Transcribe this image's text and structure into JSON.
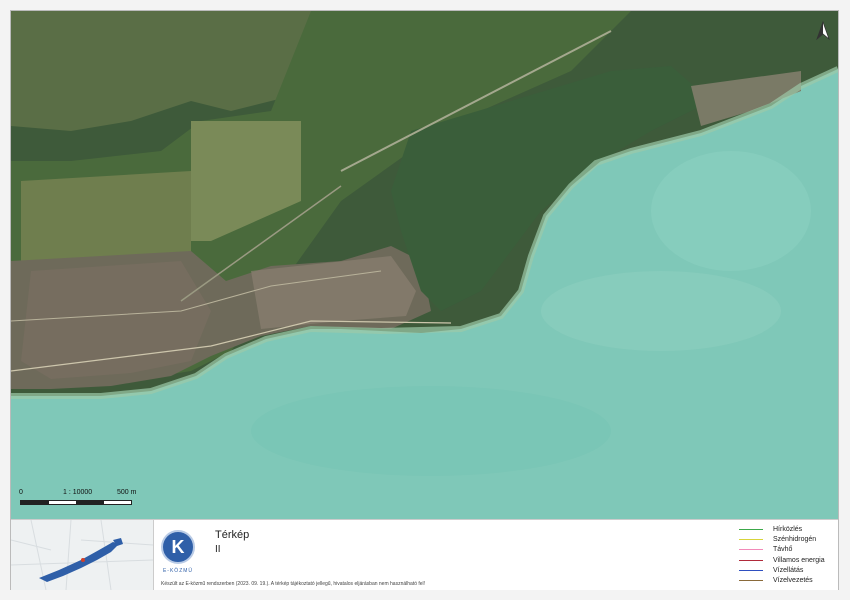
{
  "map": {
    "north_arrow": "north-arrow-icon",
    "scale": {
      "zero": "0",
      "ratio": "1 : 10000",
      "length": "500 m"
    }
  },
  "footer": {
    "logo": {
      "letter": "K",
      "brand": "E-KÖZMŰ"
    },
    "title": "Térkép",
    "subtitle": "II",
    "disclaimer": "Készült az E-közmű rendszerben (2023. 09. 19.). A térkép tájékoztató jellegű, hivatalos eljárásban nem használható fel!"
  },
  "legend": [
    {
      "label": "Hírközlés",
      "color": "#3ca84a"
    },
    {
      "label": "Szénhidrogén",
      "color": "#d8d43a"
    },
    {
      "label": "Távhő",
      "color": "#f28ab8"
    },
    {
      "label": "Villamos energia",
      "color": "#b02a3a"
    },
    {
      "label": "Vízellátás",
      "color": "#2f4fc0"
    },
    {
      "label": "Vízelvezetés",
      "color": "#8a6a3a"
    }
  ]
}
